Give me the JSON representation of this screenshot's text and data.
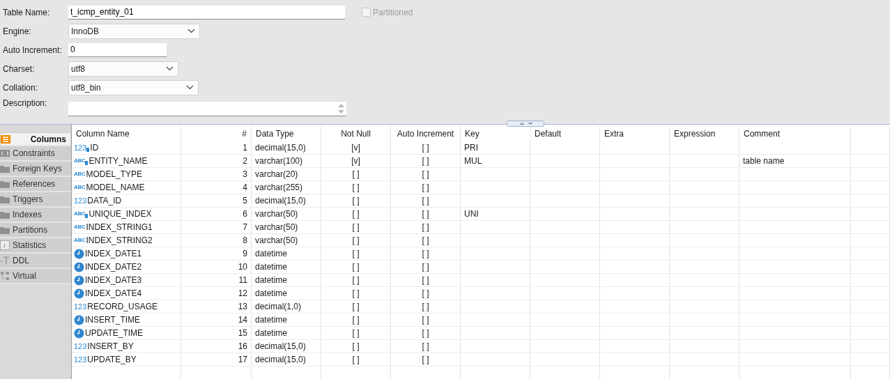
{
  "form": {
    "table_name": {
      "label": "Table Name:",
      "value": "t_icmp_entity_01"
    },
    "partitioned": {
      "label": "Partitioned",
      "checked": false,
      "disabled": true
    },
    "engine": {
      "label": "Engine:",
      "value": "InnoDB"
    },
    "auto_increment": {
      "label": "Auto Increment:",
      "value": "0"
    },
    "charset": {
      "label": "Charset:",
      "value": "utf8"
    },
    "collation": {
      "label": "Collation:",
      "value": "utf8_bin"
    },
    "description": {
      "label": "Description:"
    }
  },
  "side_tabs": [
    {
      "label": "Columns",
      "kind": "columns",
      "selected": true
    },
    {
      "label": "Constraints",
      "kind": "constraints",
      "selected": false
    },
    {
      "label": "Foreign Keys",
      "kind": "folder",
      "selected": false
    },
    {
      "label": "References",
      "kind": "folder",
      "selected": false
    },
    {
      "label": "Triggers",
      "kind": "folder",
      "selected": false
    },
    {
      "label": "Indexes",
      "kind": "folder",
      "selected": false
    },
    {
      "label": "Partitions",
      "kind": "folder",
      "selected": false
    },
    {
      "label": "Statistics",
      "kind": "info",
      "glyph": "i",
      "selected": false
    },
    {
      "label": "DDL",
      "kind": "ddl",
      "selected": false
    },
    {
      "label": "Virtual",
      "kind": "virtual",
      "selected": false
    }
  ],
  "table": {
    "columns": [
      "Column Name",
      "#",
      "Data Type",
      "Not Null",
      "Auto Increment",
      "Key",
      "Default",
      "Extra",
      "Expression",
      "Comment"
    ],
    "rows": [
      {
        "kind": "number",
        "badge": "123",
        "keyed": true,
        "cells": [
          "ID",
          "1",
          "decimal(15,0)",
          "[v]",
          "[ ]",
          "PRI",
          "",
          "",
          "",
          ""
        ]
      },
      {
        "kind": "text",
        "badge": "ABC",
        "keyed": true,
        "cells": [
          "ENTITY_NAME",
          "2",
          "varchar(100)",
          "[v]",
          "[ ]",
          "MUL",
          "",
          "",
          "",
          "table name"
        ]
      },
      {
        "kind": "text",
        "badge": "ABC",
        "keyed": false,
        "cells": [
          "MODEL_TYPE",
          "3",
          "varchar(20)",
          "[ ]",
          "[ ]",
          "",
          "",
          "",
          "",
          ""
        ]
      },
      {
        "kind": "text",
        "badge": "ABC",
        "keyed": false,
        "cells": [
          "MODEL_NAME",
          "4",
          "varchar(255)",
          "[ ]",
          "[ ]",
          "",
          "",
          "",
          "",
          ""
        ]
      },
      {
        "kind": "number",
        "badge": "123",
        "keyed": false,
        "cells": [
          "DATA_ID",
          "5",
          "decimal(15,0)",
          "[ ]",
          "[ ]",
          "",
          "",
          "",
          "",
          ""
        ]
      },
      {
        "kind": "text",
        "badge": "ABC",
        "keyed": true,
        "cells": [
          "UNIQUE_INDEX",
          "6",
          "varchar(50)",
          "[ ]",
          "[ ]",
          "UNI",
          "",
          "",
          "",
          ""
        ]
      },
      {
        "kind": "text",
        "badge": "ABC",
        "keyed": false,
        "cells": [
          "INDEX_STRING1",
          "7",
          "varchar(50)",
          "[ ]",
          "[ ]",
          "",
          "",
          "",
          "",
          ""
        ]
      },
      {
        "kind": "text",
        "badge": "ABC",
        "keyed": false,
        "cells": [
          "INDEX_STRING2",
          "8",
          "varchar(50)",
          "[ ]",
          "[ ]",
          "",
          "",
          "",
          "",
          ""
        ]
      },
      {
        "kind": "datetime",
        "keyed": false,
        "cells": [
          "INDEX_DATE1",
          "9",
          "datetime",
          "[ ]",
          "[ ]",
          "",
          "",
          "",
          "",
          ""
        ]
      },
      {
        "kind": "datetime",
        "keyed": false,
        "cells": [
          "INDEX_DATE2",
          "10",
          "datetime",
          "[ ]",
          "[ ]",
          "",
          "",
          "",
          "",
          ""
        ]
      },
      {
        "kind": "datetime",
        "keyed": false,
        "cells": [
          "INDEX_DATE3",
          "11",
          "datetime",
          "[ ]",
          "[ ]",
          "",
          "",
          "",
          "",
          ""
        ]
      },
      {
        "kind": "datetime",
        "keyed": false,
        "cells": [
          "INDEX_DATE4",
          "12",
          "datetime",
          "[ ]",
          "[ ]",
          "",
          "",
          "",
          "",
          ""
        ]
      },
      {
        "kind": "number",
        "badge": "123",
        "keyed": false,
        "cells": [
          "RECORD_USAGE",
          "13",
          "decimal(1,0)",
          "[ ]",
          "[ ]",
          "",
          "",
          "",
          "",
          ""
        ]
      },
      {
        "kind": "datetime",
        "keyed": false,
        "cells": [
          "INSERT_TIME",
          "14",
          "datetime",
          "[ ]",
          "[ ]",
          "",
          "",
          "",
          "",
          ""
        ]
      },
      {
        "kind": "datetime",
        "keyed": false,
        "cells": [
          "UPDATE_TIME",
          "15",
          "datetime",
          "[ ]",
          "[ ]",
          "",
          "",
          "",
          "",
          ""
        ]
      },
      {
        "kind": "number",
        "badge": "123",
        "keyed": false,
        "cells": [
          "INSERT_BY",
          "16",
          "decimal(15,0)",
          "[ ]",
          "[ ]",
          "",
          "",
          "",
          "",
          ""
        ]
      },
      {
        "kind": "number",
        "badge": "123",
        "keyed": false,
        "cells": [
          "UPDATE_BY",
          "17",
          "decimal(15,0)",
          "[ ]",
          "[ ]",
          "",
          "",
          "",
          "",
          ""
        ]
      }
    ]
  }
}
